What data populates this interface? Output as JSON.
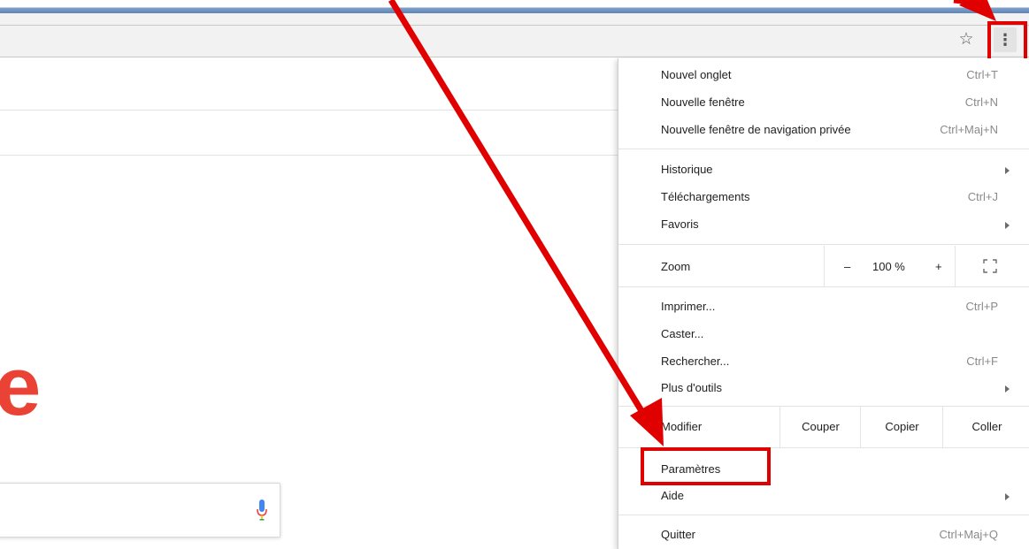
{
  "toolbar": {
    "star_icon": "star-icon",
    "menu_icon": "vertical-dots-icon"
  },
  "page": {
    "logo_fragment": "e",
    "mic_icon": "microphone-icon"
  },
  "menu": {
    "new_tab": {
      "label": "Nouvel onglet",
      "shortcut": "Ctrl+T"
    },
    "new_window": {
      "label": "Nouvelle fenêtre",
      "shortcut": "Ctrl+N"
    },
    "new_incognito": {
      "label": "Nouvelle fenêtre de navigation privée",
      "shortcut": "Ctrl+Maj+N"
    },
    "history": {
      "label": "Historique"
    },
    "downloads": {
      "label": "Téléchargements",
      "shortcut": "Ctrl+J"
    },
    "bookmarks": {
      "label": "Favoris"
    },
    "zoom": {
      "label": "Zoom",
      "minus": "–",
      "value": "100 %",
      "plus": "+"
    },
    "print": {
      "label": "Imprimer...",
      "shortcut": "Ctrl+P"
    },
    "cast": {
      "label": "Caster..."
    },
    "find": {
      "label": "Rechercher...",
      "shortcut": "Ctrl+F"
    },
    "more_tools": {
      "label": "Plus d'outils"
    },
    "edit": {
      "label": "Modifier",
      "cut": "Couper",
      "copy": "Copier",
      "paste": "Coller"
    },
    "settings": {
      "label": "Paramètres"
    },
    "help": {
      "label": "Aide"
    },
    "quit": {
      "label": "Quitter",
      "shortcut": "Ctrl+Maj+Q"
    }
  },
  "annotation": {
    "color": "#e00000"
  }
}
